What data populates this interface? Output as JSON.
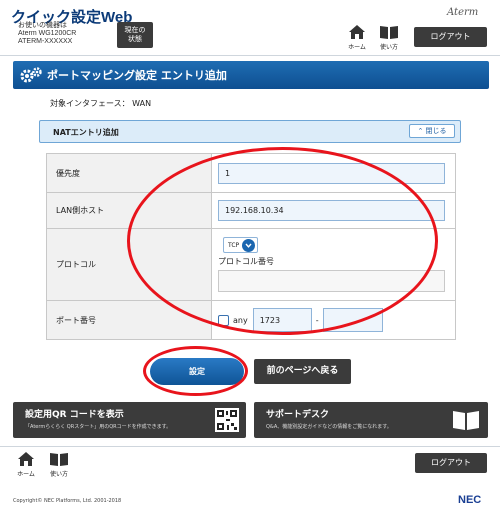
{
  "header": {
    "app_title": "クイック設定Web",
    "device_caption": "お使いの機器は",
    "device_model": "Aterm WG1200CR",
    "device_serial": "ATERM-XXXXXX",
    "status_button": "現在の\n状態",
    "brand_logo": "Aterm",
    "home_label": "ホーム",
    "help_label": "使い方",
    "logout_label": "ログアウト"
  },
  "page": {
    "title": "ポートマッピング設定 エントリ追加",
    "interface_label": "対象インタフェース：",
    "interface_value": "WAN"
  },
  "section": {
    "title": "NATエントリ追加",
    "collapse_label": "閉じる"
  },
  "form": {
    "priority_label": "優先度",
    "priority_value": "1",
    "lan_host_label": "LAN側ホスト",
    "lan_host_value": "192.168.10.34",
    "protocol_label": "プロトコル",
    "protocol_selected": "TCP",
    "protocol_number_label": "プロトコル番号",
    "protocol_number_value": "",
    "port_label": "ポート番号",
    "any_label": "any",
    "port_from": "1723",
    "port_separator": "-",
    "port_to": ""
  },
  "actions": {
    "submit_label": "設定",
    "back_label": "前のページへ戻る"
  },
  "cards": {
    "qr_title": "設定用QR コードを表示",
    "qr_subtitle": "「Atermらくらく QRスタート」用のQRコードを作成できます。",
    "support_title": "サポートデスク",
    "support_subtitle": "Q&A、機能別設定ガイドなどの情報をご覧になれます。"
  },
  "footer": {
    "home_label": "ホーム",
    "help_label": "使い方",
    "logout_label": "ログアウト",
    "copyright": "Copyright© NEC Platforms, Ltd. 2001-2018",
    "nec_logo": "NEC"
  },
  "colors": {
    "accent_blue": "#1a66b0",
    "annotation_red": "#e8141c",
    "dark_button": "#3b3b3b"
  }
}
